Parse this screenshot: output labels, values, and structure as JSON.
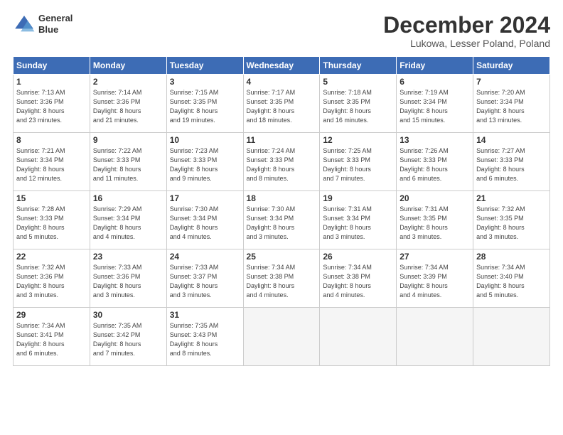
{
  "header": {
    "logo_line1": "General",
    "logo_line2": "Blue",
    "title": "December 2024",
    "subtitle": "Lukowa, Lesser Poland, Poland"
  },
  "days_of_week": [
    "Sunday",
    "Monday",
    "Tuesday",
    "Wednesday",
    "Thursday",
    "Friday",
    "Saturday"
  ],
  "weeks": [
    [
      {
        "day": "1",
        "info": "Sunrise: 7:13 AM\nSunset: 3:36 PM\nDaylight: 8 hours\nand 23 minutes."
      },
      {
        "day": "2",
        "info": "Sunrise: 7:14 AM\nSunset: 3:36 PM\nDaylight: 8 hours\nand 21 minutes."
      },
      {
        "day": "3",
        "info": "Sunrise: 7:15 AM\nSunset: 3:35 PM\nDaylight: 8 hours\nand 19 minutes."
      },
      {
        "day": "4",
        "info": "Sunrise: 7:17 AM\nSunset: 3:35 PM\nDaylight: 8 hours\nand 18 minutes."
      },
      {
        "day": "5",
        "info": "Sunrise: 7:18 AM\nSunset: 3:35 PM\nDaylight: 8 hours\nand 16 minutes."
      },
      {
        "day": "6",
        "info": "Sunrise: 7:19 AM\nSunset: 3:34 PM\nDaylight: 8 hours\nand 15 minutes."
      },
      {
        "day": "7",
        "info": "Sunrise: 7:20 AM\nSunset: 3:34 PM\nDaylight: 8 hours\nand 13 minutes."
      }
    ],
    [
      {
        "day": "8",
        "info": "Sunrise: 7:21 AM\nSunset: 3:34 PM\nDaylight: 8 hours\nand 12 minutes."
      },
      {
        "day": "9",
        "info": "Sunrise: 7:22 AM\nSunset: 3:33 PM\nDaylight: 8 hours\nand 11 minutes."
      },
      {
        "day": "10",
        "info": "Sunrise: 7:23 AM\nSunset: 3:33 PM\nDaylight: 8 hours\nand 9 minutes."
      },
      {
        "day": "11",
        "info": "Sunrise: 7:24 AM\nSunset: 3:33 PM\nDaylight: 8 hours\nand 8 minutes."
      },
      {
        "day": "12",
        "info": "Sunrise: 7:25 AM\nSunset: 3:33 PM\nDaylight: 8 hours\nand 7 minutes."
      },
      {
        "day": "13",
        "info": "Sunrise: 7:26 AM\nSunset: 3:33 PM\nDaylight: 8 hours\nand 6 minutes."
      },
      {
        "day": "14",
        "info": "Sunrise: 7:27 AM\nSunset: 3:33 PM\nDaylight: 8 hours\nand 6 minutes."
      }
    ],
    [
      {
        "day": "15",
        "info": "Sunrise: 7:28 AM\nSunset: 3:33 PM\nDaylight: 8 hours\nand 5 minutes."
      },
      {
        "day": "16",
        "info": "Sunrise: 7:29 AM\nSunset: 3:34 PM\nDaylight: 8 hours\nand 4 minutes."
      },
      {
        "day": "17",
        "info": "Sunrise: 7:30 AM\nSunset: 3:34 PM\nDaylight: 8 hours\nand 4 minutes."
      },
      {
        "day": "18",
        "info": "Sunrise: 7:30 AM\nSunset: 3:34 PM\nDaylight: 8 hours\nand 3 minutes."
      },
      {
        "day": "19",
        "info": "Sunrise: 7:31 AM\nSunset: 3:34 PM\nDaylight: 8 hours\nand 3 minutes."
      },
      {
        "day": "20",
        "info": "Sunrise: 7:31 AM\nSunset: 3:35 PM\nDaylight: 8 hours\nand 3 minutes."
      },
      {
        "day": "21",
        "info": "Sunrise: 7:32 AM\nSunset: 3:35 PM\nDaylight: 8 hours\nand 3 minutes."
      }
    ],
    [
      {
        "day": "22",
        "info": "Sunrise: 7:32 AM\nSunset: 3:36 PM\nDaylight: 8 hours\nand 3 minutes."
      },
      {
        "day": "23",
        "info": "Sunrise: 7:33 AM\nSunset: 3:36 PM\nDaylight: 8 hours\nand 3 minutes."
      },
      {
        "day": "24",
        "info": "Sunrise: 7:33 AM\nSunset: 3:37 PM\nDaylight: 8 hours\nand 3 minutes."
      },
      {
        "day": "25",
        "info": "Sunrise: 7:34 AM\nSunset: 3:38 PM\nDaylight: 8 hours\nand 4 minutes."
      },
      {
        "day": "26",
        "info": "Sunrise: 7:34 AM\nSunset: 3:38 PM\nDaylight: 8 hours\nand 4 minutes."
      },
      {
        "day": "27",
        "info": "Sunrise: 7:34 AM\nSunset: 3:39 PM\nDaylight: 8 hours\nand 4 minutes."
      },
      {
        "day": "28",
        "info": "Sunrise: 7:34 AM\nSunset: 3:40 PM\nDaylight: 8 hours\nand 5 minutes."
      }
    ],
    [
      {
        "day": "29",
        "info": "Sunrise: 7:34 AM\nSunset: 3:41 PM\nDaylight: 8 hours\nand 6 minutes."
      },
      {
        "day": "30",
        "info": "Sunrise: 7:35 AM\nSunset: 3:42 PM\nDaylight: 8 hours\nand 7 minutes."
      },
      {
        "day": "31",
        "info": "Sunrise: 7:35 AM\nSunset: 3:43 PM\nDaylight: 8 hours\nand 8 minutes."
      },
      {
        "day": "",
        "info": ""
      },
      {
        "day": "",
        "info": ""
      },
      {
        "day": "",
        "info": ""
      },
      {
        "day": "",
        "info": ""
      }
    ]
  ]
}
